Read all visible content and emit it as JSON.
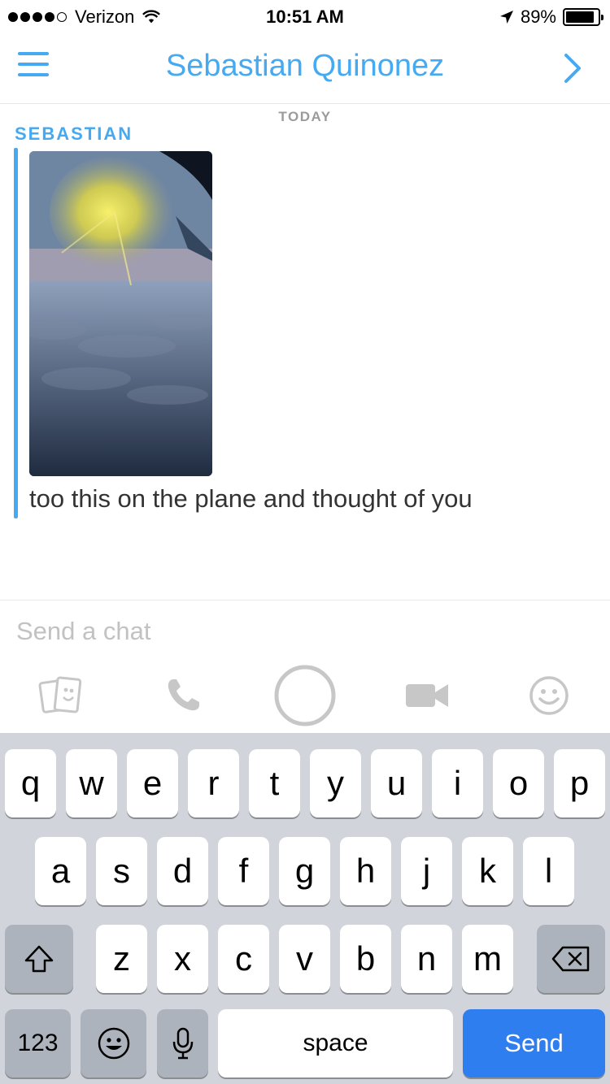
{
  "status_bar": {
    "carrier": "Verizon",
    "time": "10:51 AM",
    "battery": "89%",
    "battery_level": 0.89
  },
  "header": {
    "title": "Sebastian Quinonez"
  },
  "chat": {
    "day_label": "TODAY",
    "sender": "SEBASTIAN",
    "message_text": "too this on the plane and thought of you"
  },
  "compose": {
    "placeholder": "Send a chat"
  },
  "keyboard": {
    "row1": [
      "q",
      "w",
      "e",
      "r",
      "t",
      "y",
      "u",
      "i",
      "o",
      "p"
    ],
    "row2": [
      "a",
      "s",
      "d",
      "f",
      "g",
      "h",
      "j",
      "k",
      "l"
    ],
    "row3": [
      "z",
      "x",
      "c",
      "v",
      "b",
      "n",
      "m"
    ],
    "numbers_label": "123",
    "space_label": "space",
    "send_label": "Send"
  },
  "colors": {
    "accent": "#45aaf2",
    "send_button": "#2f7ef0",
    "keyboard_bg": "#d1d5db"
  },
  "icons": [
    "wifi-icon",
    "location-arrow-icon",
    "menu-icon",
    "chevron-right-icon",
    "gallery-icon",
    "phone-icon",
    "capture-icon",
    "video-icon",
    "smiley-icon",
    "shift-icon",
    "backspace-icon",
    "emoji-icon",
    "microphone-icon"
  ]
}
